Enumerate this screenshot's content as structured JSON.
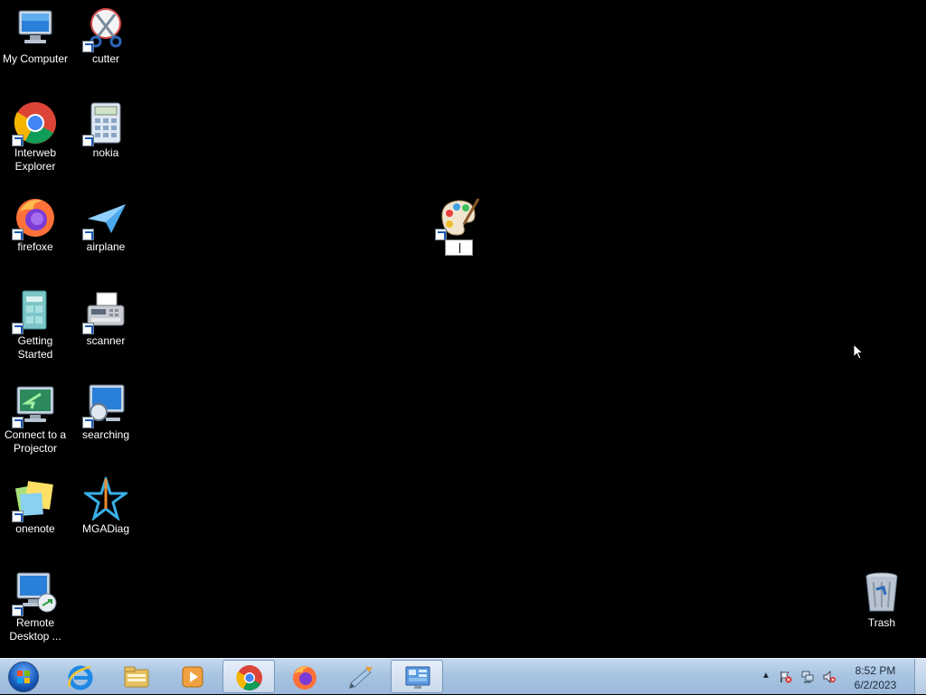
{
  "desktop": {
    "icons": [
      {
        "label": "My Computer",
        "icon": "computer-icon"
      },
      {
        "label": "cutter",
        "icon": "scissors-icon"
      },
      {
        "label": "Interweb Explorer",
        "icon": "chrome-icon"
      },
      {
        "label": "nokia",
        "icon": "calculator-icon"
      },
      {
        "label": "firefoxe",
        "icon": "firefox-icon"
      },
      {
        "label": "airplane",
        "icon": "paper-plane-icon"
      },
      {
        "label": "Getting Started",
        "icon": "getting-started-icon"
      },
      {
        "label": "scanner",
        "icon": "fax-scanner-icon"
      },
      {
        "label": "Connect to a Projector",
        "icon": "projector-monitor-icon"
      },
      {
        "label": "searching",
        "icon": "search-monitor-icon"
      },
      {
        "label": "onenote",
        "icon": "sticky-notes-icon"
      },
      {
        "label": "MGADiag",
        "icon": "star-icon"
      },
      {
        "label": "Remote Desktop ...",
        "icon": "remote-desktop-icon"
      },
      {
        "label": "Trash",
        "icon": "recycle-bin-icon"
      },
      {
        "label": "",
        "icon": "paint-palette-icon"
      }
    ],
    "rename_value": ""
  },
  "taskbar": {
    "buttons": [
      {
        "name": "internet-explorer",
        "icon": "ie-icon"
      },
      {
        "name": "file-explorer",
        "icon": "folder-icon"
      },
      {
        "name": "media-player",
        "icon": "media-player-icon"
      },
      {
        "name": "chrome",
        "icon": "chrome-icon",
        "active": true
      },
      {
        "name": "firefox",
        "icon": "firefox-icon"
      },
      {
        "name": "paint-tool",
        "icon": "paint-brush-icon"
      },
      {
        "name": "control-panel",
        "icon": "control-panel-icon",
        "active": true
      }
    ],
    "clock": {
      "time": "8:52 PM",
      "date": "6/2/2023"
    }
  }
}
